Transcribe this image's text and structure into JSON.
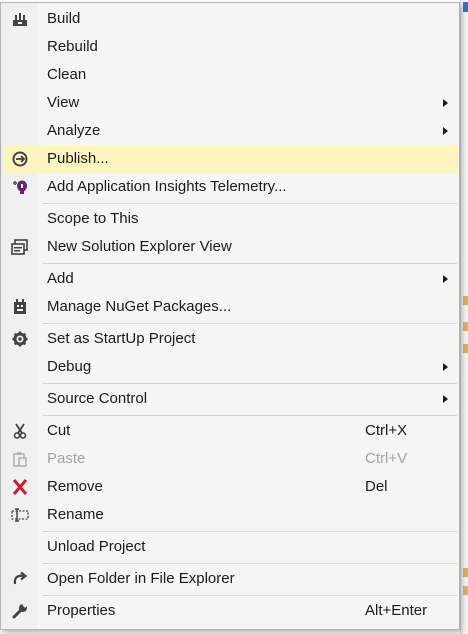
{
  "menu": {
    "items": [
      {
        "label": "Build",
        "icon": "build-icon"
      },
      {
        "label": "Rebuild"
      },
      {
        "label": "Clean"
      },
      {
        "label": "View",
        "submenu": true
      },
      {
        "label": "Analyze",
        "submenu": true
      },
      {
        "label": "Publish...",
        "icon": "publish-icon",
        "highlighted": true
      },
      {
        "label": "Add Application Insights Telemetry...",
        "icon": "app-insights-icon"
      },
      {
        "label": "Scope to This"
      },
      {
        "label": "New Solution Explorer View",
        "icon": "solution-explorer-icon"
      },
      {
        "label": "Add",
        "submenu": true
      },
      {
        "label": "Manage NuGet Packages...",
        "icon": "nuget-icon"
      },
      {
        "label": "Set as StartUp Project",
        "icon": "gear-icon"
      },
      {
        "label": "Debug",
        "submenu": true
      },
      {
        "label": "Source Control",
        "submenu": true
      },
      {
        "label": "Cut",
        "shortcut": "Ctrl+X",
        "icon": "cut-icon"
      },
      {
        "label": "Paste",
        "shortcut": "Ctrl+V",
        "icon": "paste-icon",
        "disabled": true
      },
      {
        "label": "Remove",
        "shortcut": "Del",
        "icon": "remove-icon"
      },
      {
        "label": "Rename",
        "icon": "rename-icon"
      },
      {
        "label": "Unload Project"
      },
      {
        "label": "Open Folder in File Explorer",
        "icon": "open-folder-icon"
      },
      {
        "label": "Properties",
        "shortcut": "Alt+Enter",
        "icon": "wrench-icon"
      }
    ]
  },
  "colors": {
    "menu_bg": "#f5f5f5",
    "highlight": "#fdf4bf",
    "separator": "#d6d6d6",
    "text": "#1b1b1b",
    "disabled_text": "#a4a4a4"
  }
}
